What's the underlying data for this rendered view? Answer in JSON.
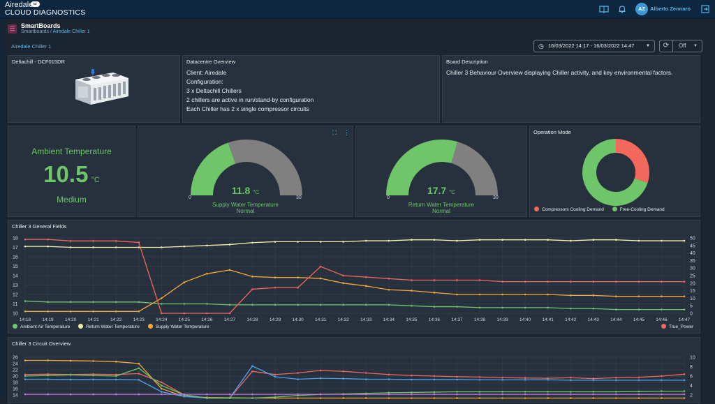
{
  "topbar": {
    "brand_line1": "Airedale",
    "brand_line2": "CLOUD DIAGNOSTICS",
    "cloud_badge": "ad",
    "avatar_initials": "AZ",
    "user_name": "Alberto Zennaro",
    "icons": [
      "book-icon",
      "bell-icon",
      "logout-icon"
    ]
  },
  "header": {
    "title": "SmartBoards",
    "breadcrumb": "Smartboards / Airedale Chiller 1",
    "board_name": "Airedale Chiller 1",
    "date_range": "16/03/2022 14:17 - 16/03/2022 14:47",
    "refresh_mode": "Off"
  },
  "panels": {
    "unit": {
      "title": "Deltachill - DCF015DR"
    },
    "datacentre": {
      "title": "Datacentre Overview",
      "lines": [
        "Client: Airedale",
        "Configuration:",
        "3 x Deltachill Chillers",
        "2 chillers are active in run/stand-by configuration",
        "Each Chiller has 2 x single compressor circuits"
      ]
    },
    "board": {
      "title": "Board Description",
      "text": "Chiller 3 Behaviour Overview displaying Chiller activity, and key environmental factors."
    },
    "ambient": {
      "title": "Ambient Temperature",
      "value": "10.5",
      "unit": "°C",
      "state": "Medium"
    },
    "supply": {
      "value": "11.8",
      "unit": "°C",
      "label": "Supply Water Temperature",
      "state": "Normal",
      "min": "0",
      "max": "30",
      "fraction": 0.393
    },
    "return": {
      "value": "17.7",
      "unit": "°C",
      "label": "Return Water Temperature",
      "state": "Normal",
      "min": "0",
      "max": "30",
      "fraction": 0.59
    },
    "operation": {
      "title": "Operation Mode",
      "legend": [
        "Compressors Cooling Demand",
        "Free-Cooling Demand"
      ],
      "values": [
        30,
        70
      ],
      "colors": [
        "#f2685c",
        "#6fc56a"
      ]
    }
  },
  "colors": {
    "green": "#6fc56a",
    "grey": "#808080",
    "red": "#f2685c",
    "yellow": "#f5f0a8",
    "orange": "#f5a93a",
    "blue": "#4aa3ef"
  },
  "chart_data": [
    {
      "type": "line",
      "title": "Chiller 3 General Fields",
      "x": [
        "14:18",
        "14:19",
        "14:20",
        "14:21",
        "14:22",
        "14:23",
        "14:24",
        "14:25",
        "14:26",
        "14:27",
        "14:28",
        "14:29",
        "14:30",
        "14:31",
        "14:32",
        "14:33",
        "14:34",
        "14:35",
        "14:36",
        "14:37",
        "14:38",
        "14:39",
        "14:40",
        "14:41",
        "14:42",
        "14:43",
        "14:44",
        "14:45",
        "14:46",
        "14:47"
      ],
      "ylim_left": [
        10,
        18
      ],
      "ylim_right": [
        0,
        50
      ],
      "left_ticks": [
        "18",
        "17",
        "16",
        "15",
        "14",
        "13",
        "12",
        "11",
        "10"
      ],
      "right_ticks": [
        "50",
        "45",
        "40",
        "35",
        "30",
        "25",
        "20",
        "15",
        "10",
        "5",
        "0"
      ],
      "series": [
        {
          "name": "Ambient Air Temperature",
          "axis": "left",
          "color": "#6fc56a",
          "values": [
            11.3,
            11.2,
            11.2,
            11.2,
            11.2,
            11.2,
            11.0,
            11.0,
            11.0,
            10.9,
            10.9,
            10.9,
            10.9,
            10.9,
            10.9,
            10.9,
            10.9,
            10.8,
            10.7,
            10.7,
            10.6,
            10.6,
            10.6,
            10.6,
            10.5,
            10.5,
            10.4,
            10.4,
            10.4,
            10.4
          ]
        },
        {
          "name": "Return Water Temperature",
          "axis": "left",
          "color": "#f5f0a8",
          "values": [
            17.1,
            17.1,
            17.0,
            17.0,
            17.0,
            17.0,
            17.0,
            17.1,
            17.2,
            17.3,
            17.5,
            17.6,
            17.6,
            17.6,
            17.6,
            17.7,
            17.7,
            17.8,
            17.8,
            17.7,
            17.8,
            17.8,
            17.8,
            17.8,
            17.7,
            17.8,
            17.8,
            17.7,
            17.7,
            17.7
          ]
        },
        {
          "name": "Supply Water Temperature",
          "axis": "left",
          "color": "#f5a93a",
          "values": [
            10.2,
            10.2,
            10.2,
            10.2,
            10.2,
            10.2,
            11.6,
            13.3,
            14.2,
            14.6,
            13.9,
            13.8,
            13.8,
            13.7,
            13.2,
            12.9,
            12.5,
            12.4,
            12.2,
            12.0,
            12.0,
            12.0,
            12.0,
            12.0,
            11.9,
            11.9,
            11.8,
            11.8,
            11.8,
            11.8
          ]
        },
        {
          "name": "True_Power",
          "axis": "right",
          "color": "#f2685c",
          "values": [
            49,
            49,
            48,
            48,
            48,
            47,
            0,
            0,
            0,
            0,
            16,
            17,
            17,
            31,
            25,
            24,
            23,
            22,
            22,
            22,
            22,
            21,
            21,
            21,
            21,
            21,
            21,
            21,
            21,
            21
          ]
        }
      ]
    },
    {
      "type": "line",
      "title": "Chiller 3 Circuit Overview",
      "ylim_left": [
        14,
        26
      ],
      "ylim_right": [
        2,
        10
      ],
      "left_ticks": [
        "26",
        "24",
        "22",
        "20",
        "18",
        "16",
        "14"
      ],
      "right_ticks": [
        "10",
        "8",
        "6",
        "4",
        "2"
      ],
      "series": [
        {
          "color": "#f5a93a",
          "values": [
            25.0,
            25.0,
            24.9,
            24.8,
            24.6,
            24.0,
            16.0,
            13.5,
            13.2,
            13.1,
            13.0,
            13.0,
            13.0,
            13.0,
            13.0,
            13.0,
            13.0,
            13.0,
            13.0,
            13.0,
            13.0,
            13.0,
            13.0,
            13.0,
            13.0,
            13.0,
            13.0,
            13.0,
            13.0,
            13.0
          ]
        },
        {
          "color": "#f2685c",
          "values": [
            20.5,
            20.6,
            20.5,
            20.6,
            20.5,
            20.8,
            18.0,
            14.0,
            13.0,
            13.0,
            21.5,
            20.5,
            21.0,
            21.8,
            21.5,
            21.0,
            20.5,
            20.2,
            20.0,
            19.8,
            19.7,
            19.5,
            19.4,
            19.3,
            19.5,
            19.2,
            19.5,
            19.6,
            20.0,
            20.6
          ]
        },
        {
          "color": "#4aa3ef",
          "values": [
            19.0,
            19.0,
            18.9,
            18.9,
            18.9,
            18.8,
            15.0,
            13.5,
            13.0,
            13.0,
            23.2,
            19.8,
            19.0,
            19.3,
            19.2,
            19.0,
            19.0,
            18.9,
            18.9,
            18.9,
            18.8,
            18.8,
            18.8,
            18.8,
            18.7,
            18.7,
            18.7,
            18.7,
            18.7,
            18.7
          ]
        },
        {
          "color": "#6fc56a",
          "values": [
            20.0,
            20.2,
            20.4,
            20.2,
            20.0,
            22.5,
            17.0,
            14.0,
            13.0,
            13.0,
            13.0,
            13.3,
            13.8,
            14.2,
            14.3,
            14.5,
            14.7,
            14.8,
            14.9,
            15.0,
            15.0,
            15.0,
            15.0,
            15.0,
            15.0,
            15.0,
            15.0,
            15.1,
            15.2,
            15.2
          ]
        },
        {
          "color": "#c070e0",
          "values": [
            14.2,
            14.2,
            14.2,
            14.2,
            14.2,
            14.2,
            14.2,
            14.2,
            14.2,
            14.2,
            14.2,
            14.2,
            14.2,
            14.2,
            14.2,
            14.2,
            14.2,
            14.2,
            14.2,
            14.2,
            14.2,
            14.2,
            14.2,
            14.2,
            14.2,
            14.2,
            14.2,
            14.2,
            14.2,
            14.2
          ]
        }
      ]
    }
  ]
}
